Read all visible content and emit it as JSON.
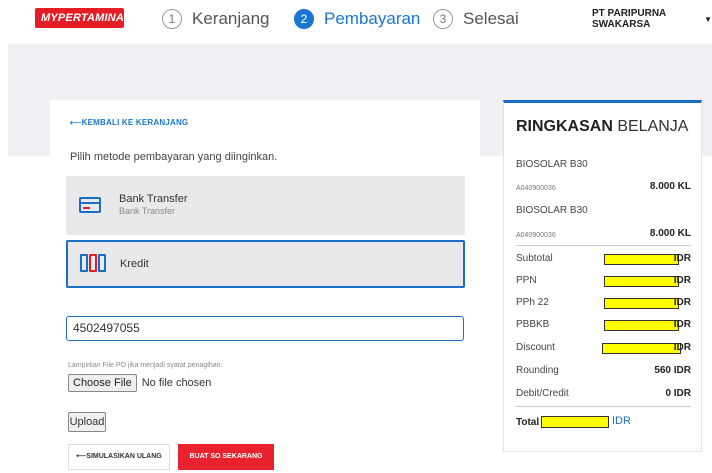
{
  "header": {
    "logo_text": "MYPERTAMINA",
    "steps": [
      {
        "number": "1",
        "label": "Keranjang"
      },
      {
        "number": "2",
        "label": "Pembayaran"
      },
      {
        "number": "3",
        "label": "Selesai"
      }
    ],
    "company": "PT PARIPURNA SWAKARSA"
  },
  "payment": {
    "back_link": "⟵KEMBALI KE KERANJANG",
    "prompt": "Pilih metode pembayaran yang diinginkan.",
    "options": [
      {
        "title": "Bank Transfer",
        "subtitle": "Bank Transfer"
      },
      {
        "title": "Kredit"
      }
    ],
    "po_number": "4502497055",
    "attach_label": "Lampirkan File PO jika menjadi syarat penagihan:",
    "choose_file_label": "Choose File",
    "no_file_text": "No file chosen",
    "upload_label": "Upload",
    "simulate_label": "⟵SIMULASIKAN ULANG",
    "submit_label": "BUAT SO SEKARANG"
  },
  "summary": {
    "title_bold": "RINGKASAN",
    "title_rest": " BELANJA",
    "items": [
      {
        "name": "BIOSOLAR B30",
        "code": "A040900036",
        "qty": "8.000 KL"
      },
      {
        "name": "BIOSOLAR B30",
        "code": "A040900036",
        "qty": "8.000 KL"
      }
    ],
    "rows": [
      {
        "label": "Subtotal",
        "value": "IDR",
        "masked": true
      },
      {
        "label": "PPN",
        "value": "IDR",
        "masked": true
      },
      {
        "label": "PPh 22",
        "value": "IDR",
        "masked": true
      },
      {
        "label": "PBBKB",
        "value": "IDR",
        "masked": true
      },
      {
        "label": "Discount",
        "value": "IDR",
        "masked": true
      },
      {
        "label": "Rounding",
        "value": "560 IDR",
        "masked": false
      },
      {
        "label": "Debit/Credit",
        "value": "0 IDR",
        "masked": false
      }
    ],
    "total_label": "Total",
    "total_currency": "IDR"
  },
  "colors": {
    "brand_red": "#e41e26",
    "accent_blue": "#1a76d2",
    "redaction_yellow": "#ffff00"
  }
}
